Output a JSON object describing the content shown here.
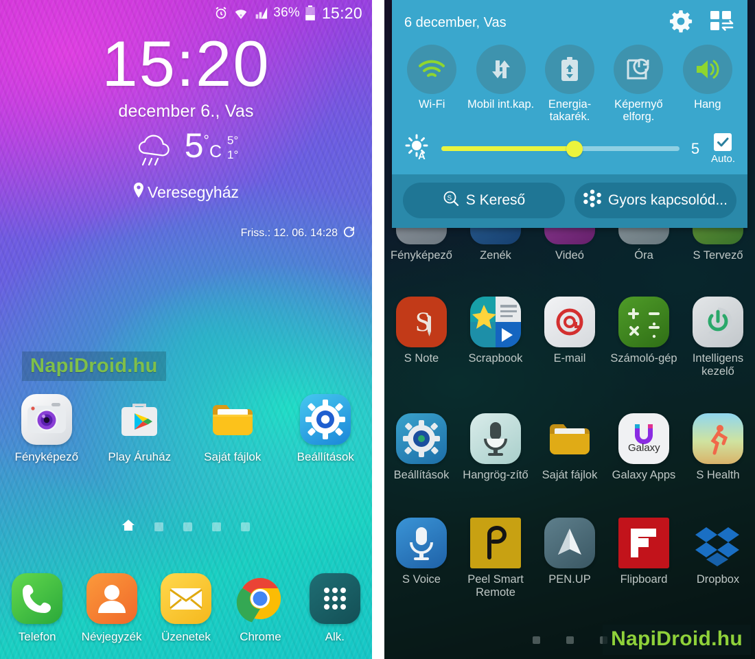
{
  "left_phone": {
    "status_bar": {
      "alarm_icon": "alarm-icon",
      "wifi_icon": "wifi-icon",
      "signal_icon": "signal-icon",
      "battery_percent": "36%",
      "battery_icon": "battery-icon",
      "clock": "15:20"
    },
    "clock_widget": {
      "time": "15:20",
      "date": "december 6., Vas"
    },
    "weather": {
      "condition_icon": "rain-cloud-icon",
      "temperature": "5",
      "degree_symbol": "°",
      "unit": "C",
      "high": "5°",
      "low": "1°",
      "location_icon": "location-pin-icon",
      "location": "Veresegyház",
      "refresh_label": "Friss.: 12. 06. 14:28",
      "refresh_icon": "refresh-icon"
    },
    "watermark": "NapiDroid.hu",
    "home_apps": [
      {
        "label": "Fényképező",
        "icon": "camera-icon"
      },
      {
        "label": "Play Áruház",
        "icon": "play-store-icon"
      },
      {
        "label": "Saját fájlok",
        "icon": "my-files-icon"
      },
      {
        "label": "Beállítások",
        "icon": "settings-gear-icon"
      }
    ],
    "page_indicator": {
      "home_icon": "home-icon",
      "dots": 4,
      "active_index": 0
    },
    "dock_apps": [
      {
        "label": "Telefon",
        "icon": "phone-icon"
      },
      {
        "label": "Névjegyzék",
        "icon": "contacts-icon"
      },
      {
        "label": "Üzenetek",
        "icon": "messages-icon"
      },
      {
        "label": "Chrome",
        "icon": "chrome-icon"
      },
      {
        "label": "Alk.",
        "icon": "apps-grid-icon"
      }
    ]
  },
  "right_phone": {
    "quick_panel": {
      "date": "6 december, Vas",
      "settings_icon": "gear-icon",
      "edit_grid_icon": "edit-quick-settings-icon",
      "toggles": [
        {
          "label": "Wi-Fi",
          "icon": "wifi-icon",
          "active": true
        },
        {
          "label": "Mobil int.kap.",
          "icon": "mobile-data-icon",
          "active": false
        },
        {
          "label": "Energia-takarék.",
          "icon": "power-saving-icon",
          "active": false
        },
        {
          "label": "Képernyő elforg.",
          "icon": "screen-rotation-icon",
          "active": false
        },
        {
          "label": "Hang",
          "icon": "sound-icon",
          "active": true
        }
      ],
      "brightness": {
        "icon": "auto-brightness-icon",
        "value": "5",
        "percent": 56,
        "auto_label": "Auto.",
        "auto_checked": true,
        "check_icon": "check-icon"
      },
      "actions": [
        {
          "label": "S Kereső",
          "icon": "s-finder-icon"
        },
        {
          "label": "Gyors kapcsolód...",
          "icon": "quick-connect-icon"
        }
      ]
    },
    "app_drawer": {
      "rows": [
        [
          {
            "label": "Fényképező",
            "icon": "camera-icon"
          },
          {
            "label": "Zenék",
            "icon": "music-icon"
          },
          {
            "label": "Videó",
            "icon": "video-icon"
          },
          {
            "label": "Óra",
            "icon": "clock-icon"
          },
          {
            "label": "S Tervező",
            "icon": "s-planner-icon"
          }
        ],
        [
          {
            "label": "S Note",
            "icon": "s-note-icon"
          },
          {
            "label": "Scrapbook",
            "icon": "scrapbook-icon"
          },
          {
            "label": "E-mail",
            "icon": "email-icon"
          },
          {
            "label": "Számoló-gép",
            "icon": "calculator-icon"
          },
          {
            "label": "Intelligens kezelő",
            "icon": "smart-manager-icon"
          }
        ],
        [
          {
            "label": "Beállítások",
            "icon": "settings-gear-icon"
          },
          {
            "label": "Hangrög-zítő",
            "icon": "voice-recorder-icon"
          },
          {
            "label": "Saját fájlok",
            "icon": "my-files-icon"
          },
          {
            "label": "Galaxy Apps",
            "icon": "galaxy-apps-icon"
          },
          {
            "label": "S Health",
            "icon": "s-health-icon"
          }
        ],
        [
          {
            "label": "S Voice",
            "icon": "s-voice-icon"
          },
          {
            "label": "Peel Smart Remote",
            "icon": "peel-remote-icon"
          },
          {
            "label": "PEN.UP",
            "icon": "penup-icon"
          },
          {
            "label": "Flipboard",
            "icon": "flipboard-icon"
          },
          {
            "label": "Dropbox",
            "icon": "dropbox-icon"
          }
        ]
      ],
      "page_dots": 3
    },
    "watermark": "NapiDroid.hu"
  },
  "colors": {
    "panel_bg": "#3aa7cd",
    "panel_actions_bg": "#2a89aa",
    "toggle_circle": "#3e93ae",
    "toggle_active": "#8fd62f",
    "slider_fill": "#e9f53f",
    "watermark_green_left": "#7fbf4a",
    "watermark_green_right": "#8fd13a"
  }
}
